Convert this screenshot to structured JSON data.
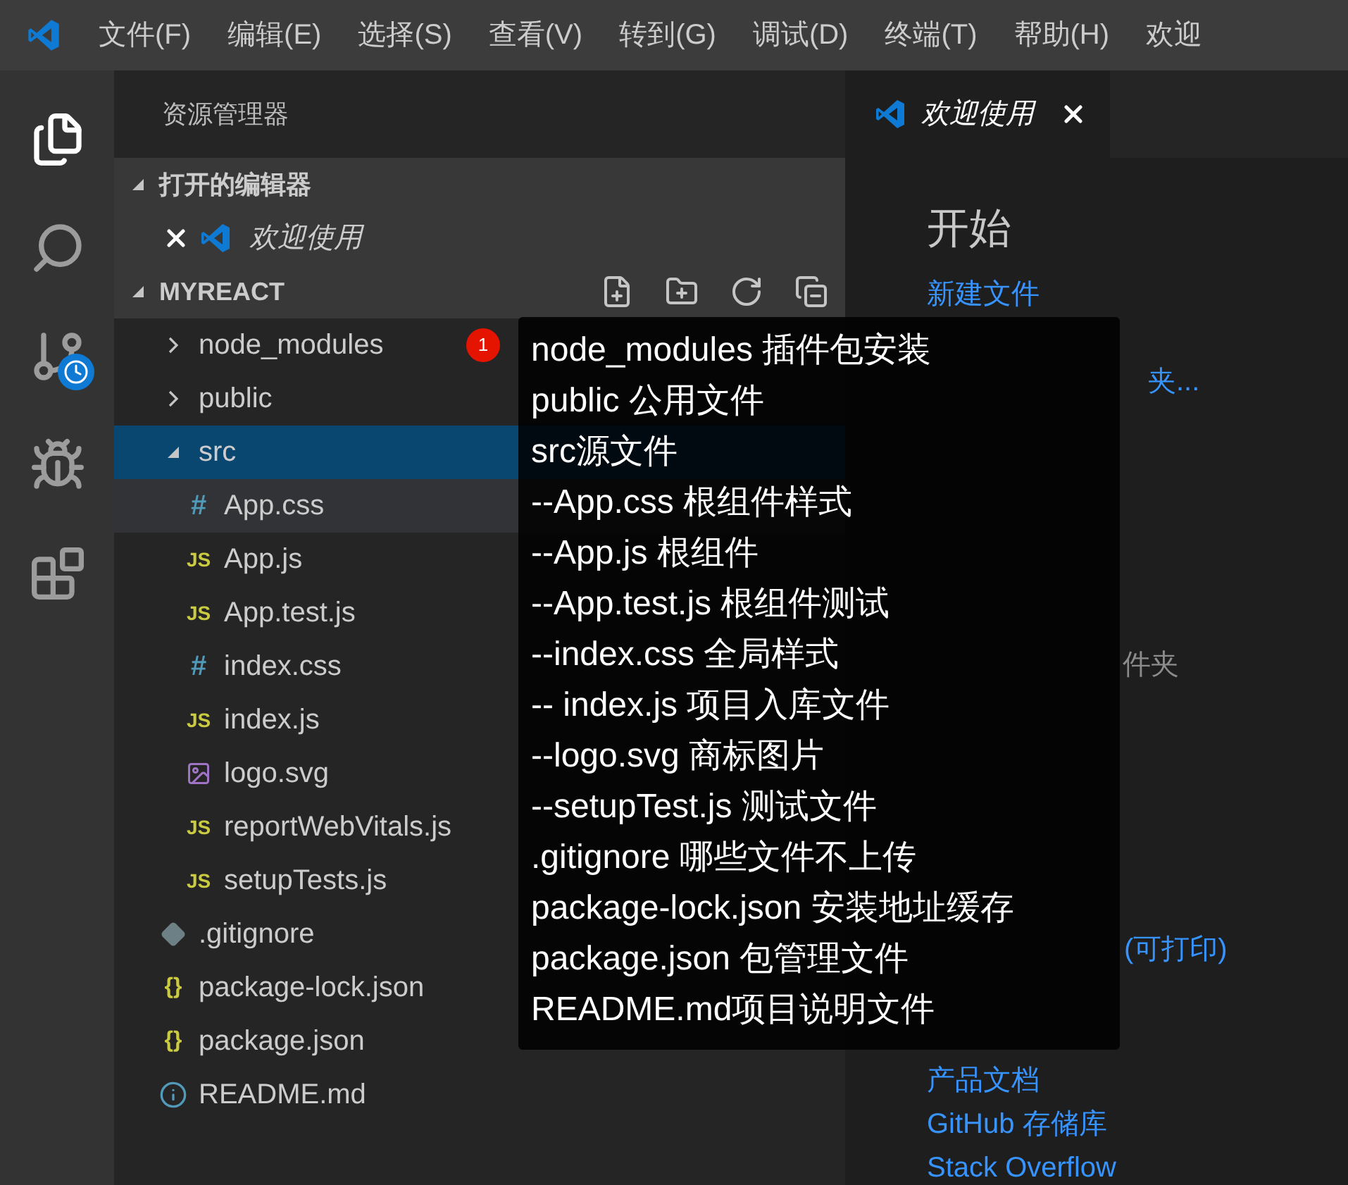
{
  "menu": [
    "文件(F)",
    "编辑(E)",
    "选择(S)",
    "查看(V)",
    "转到(G)",
    "调试(D)",
    "终端(T)",
    "帮助(H)"
  ],
  "window": {
    "title": "欢迎"
  },
  "activity_bar": [
    {
      "kind": "files",
      "selected": true
    },
    {
      "kind": "search",
      "selected": false
    },
    {
      "kind": "scm",
      "selected": false
    },
    {
      "kind": "debug",
      "selected": false
    },
    {
      "kind": "extensions",
      "selected": false
    }
  ],
  "sidebar": {
    "title": "资源管理器",
    "open_editors": {
      "label": "打开的编辑器",
      "expanded": true,
      "items": [
        {
          "label": "欢迎使用"
        }
      ]
    },
    "folder": {
      "label": "MYREACT",
      "expanded": true,
      "tree": [
        {
          "label": "node_modules",
          "kind": "folder",
          "expanded": false,
          "selected": false,
          "badge": "1"
        },
        {
          "label": "public",
          "kind": "folder",
          "expanded": false,
          "selected": false
        },
        {
          "label": "src",
          "kind": "folder",
          "expanded": true,
          "selected": true,
          "children": [
            {
              "label": "App.css",
              "kind": "css",
              "icon_text": "#",
              "selected": false,
              "hover": true
            },
            {
              "label": "App.js",
              "kind": "js",
              "icon_text": "JS",
              "selected": false
            },
            {
              "label": "App.test.js",
              "kind": "js",
              "icon_text": "JS",
              "selected": false
            },
            {
              "label": "index.css",
              "kind": "css",
              "icon_text": "#",
              "selected": false
            },
            {
              "label": "index.js",
              "kind": "js",
              "icon_text": "JS",
              "selected": false
            },
            {
              "label": "logo.svg",
              "kind": "svg",
              "selected": false
            },
            {
              "label": "reportWebVitals.js",
              "kind": "js",
              "icon_text": "JS",
              "selected": false
            },
            {
              "label": "setupTests.js",
              "kind": "js",
              "icon_text": "JS",
              "selected": false
            }
          ]
        },
        {
          "label": ".gitignore",
          "kind": "git",
          "selected": false
        },
        {
          "label": "package-lock.json",
          "kind": "json",
          "icon_text": "{}",
          "selected": false
        },
        {
          "label": "package.json",
          "kind": "json",
          "icon_text": "{}",
          "selected": false
        },
        {
          "label": "README.md",
          "kind": "info",
          "selected": false
        }
      ]
    }
  },
  "editor": {
    "tabs": [
      {
        "label": "欢迎使用",
        "selected": true
      }
    ],
    "welcome": {
      "start": {
        "heading": "开始",
        "links": [
          "新建文件",
          "夹..."
        ]
      },
      "recent": {
        "empty": "件夹"
      },
      "help": {
        "links": [
          "(可打印)",
          "产品文档",
          "GitHub 存储库",
          "Stack Overflow"
        ]
      }
    }
  },
  "tooltip": {
    "lines": [
      "node_modules 插件包安装",
      "public 公用文件",
      "src源文件",
      "--App.css 根组件样式",
      "--App.js 根组件",
      "--App.test.js 根组件测试",
      "--index.css 全局样式",
      "-- index.js 项目入库文件",
      "--logo.svg 商标图片",
      "--setupTest.js 测试文件",
      ".gitignore 哪些文件不上传",
      "package-lock.json 安装地址缓存",
      "package.json 包管理文件",
      "README.md项目说明文件"
    ]
  }
}
